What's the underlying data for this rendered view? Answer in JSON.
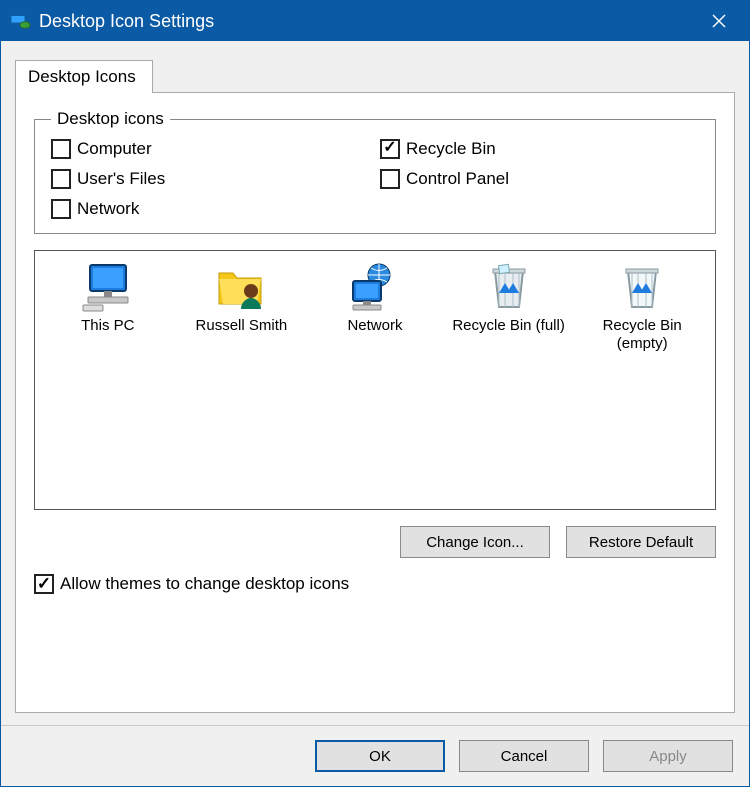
{
  "window": {
    "title": "Desktop Icon Settings"
  },
  "tab": {
    "label": "Desktop Icons"
  },
  "group": {
    "legend": "Desktop icons",
    "checks": {
      "computer": {
        "label": "Computer",
        "checked": false
      },
      "usersfiles": {
        "label": "User's Files",
        "checked": false
      },
      "network": {
        "label": "Network",
        "checked": false
      },
      "recyclebin": {
        "label": "Recycle Bin",
        "checked": true
      },
      "controlpanel": {
        "label": "Control Panel",
        "checked": false
      }
    }
  },
  "preview": {
    "items": {
      "thispc": "This PC",
      "user": "Russell Smith",
      "network": "Network",
      "rbfull": "Recycle Bin (full)",
      "rbempty": "Recycle Bin (empty)"
    }
  },
  "buttons": {
    "change_icon": "Change Icon...",
    "restore_default": "Restore Default",
    "allow_themes": "Allow themes to change desktop icons",
    "ok": "OK",
    "cancel": "Cancel",
    "apply": "Apply"
  }
}
